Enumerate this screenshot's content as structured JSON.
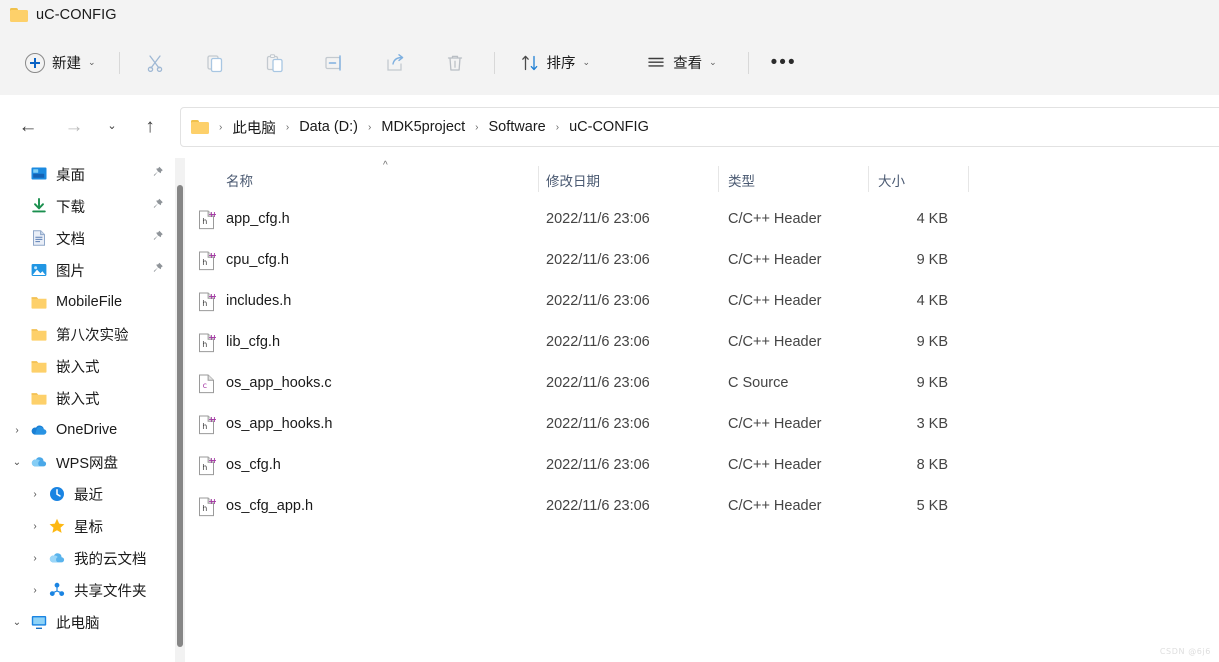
{
  "window": {
    "title": "uC-CONFIG",
    "folder_icon": "folder-icon"
  },
  "toolbar": {
    "new_label": "新建",
    "new_chevron": "⌄",
    "sort_label": "排序",
    "sort_chevron": "⌄",
    "view_label": "查看",
    "view_chevron": "⌄",
    "more_label": "•••",
    "icons": [
      {
        "name": "cut-icon",
        "tip": "剪切"
      },
      {
        "name": "copy-icon",
        "tip": "复制"
      },
      {
        "name": "paste-icon",
        "tip": "粘贴"
      },
      {
        "name": "rename-icon",
        "tip": "重命名"
      },
      {
        "name": "share-icon",
        "tip": "共享"
      },
      {
        "name": "delete-icon",
        "tip": "删除"
      }
    ]
  },
  "nav": {
    "back": "←",
    "forward": "→",
    "recent_chevron": "⌄",
    "up": "↑",
    "breadcrumb": [
      "此电脑",
      "Data (D:)",
      "MDK5project",
      "Software",
      "uC-CONFIG"
    ],
    "separator": "›"
  },
  "sidebar": {
    "items": [
      {
        "label": "桌面",
        "icon": "desktop-icon",
        "pinned": true,
        "caret": "",
        "indent": 0
      },
      {
        "label": "下载",
        "icon": "downloads-icon",
        "pinned": true,
        "caret": "",
        "indent": 0
      },
      {
        "label": "文档",
        "icon": "documents-icon",
        "pinned": true,
        "caret": "",
        "indent": 0
      },
      {
        "label": "图片",
        "icon": "pictures-icon",
        "pinned": true,
        "caret": "",
        "indent": 0
      },
      {
        "label": "MobileFile",
        "icon": "folder-icon",
        "pinned": false,
        "caret": "",
        "indent": 0
      },
      {
        "label": "第八次实验",
        "icon": "folder-icon",
        "pinned": false,
        "caret": "",
        "indent": 0
      },
      {
        "label": "嵌入式",
        "icon": "folder-icon",
        "pinned": false,
        "caret": "",
        "indent": 0
      },
      {
        "label": "嵌入式",
        "icon": "folder-icon",
        "pinned": false,
        "caret": "",
        "indent": 0
      },
      {
        "label": "OneDrive",
        "icon": "onedrive-icon",
        "pinned": false,
        "caret": "›",
        "indent": 0
      },
      {
        "label": "WPS网盘",
        "icon": "wps-cloud-icon",
        "pinned": false,
        "caret": "⌄",
        "indent": 0
      },
      {
        "label": "最近",
        "icon": "clock-icon",
        "pinned": false,
        "caret": "›",
        "indent": 1
      },
      {
        "label": "星标",
        "icon": "star-icon",
        "pinned": false,
        "caret": "›",
        "indent": 1
      },
      {
        "label": "我的云文档",
        "icon": "cloud-icon",
        "pinned": false,
        "caret": "›",
        "indent": 1
      },
      {
        "label": "共享文件夹",
        "icon": "share-folder-icon",
        "pinned": false,
        "caret": "›",
        "indent": 1
      },
      {
        "label": "此电脑",
        "icon": "this-pc-icon",
        "pinned": false,
        "caret": "⌄",
        "indent": 0
      }
    ]
  },
  "filelist": {
    "columns": {
      "name": "名称",
      "date": "修改日期",
      "type": "类型",
      "size": "大小"
    },
    "sort_indicator": "^",
    "rows": [
      {
        "name": "app_cfg.h",
        "date": "2022/11/6 23:06",
        "type": "C/C++ Header",
        "size": "4 KB",
        "icon": "h-file-icon"
      },
      {
        "name": "cpu_cfg.h",
        "date": "2022/11/6 23:06",
        "type": "C/C++ Header",
        "size": "9 KB",
        "icon": "h-file-icon"
      },
      {
        "name": "includes.h",
        "date": "2022/11/6 23:06",
        "type": "C/C++ Header",
        "size": "4 KB",
        "icon": "h-file-icon"
      },
      {
        "name": "lib_cfg.h",
        "date": "2022/11/6 23:06",
        "type": "C/C++ Header",
        "size": "9 KB",
        "icon": "h-file-icon"
      },
      {
        "name": "os_app_hooks.c",
        "date": "2022/11/6 23:06",
        "type": "C Source",
        "size": "9 KB",
        "icon": "c-file-icon"
      },
      {
        "name": "os_app_hooks.h",
        "date": "2022/11/6 23:06",
        "type": "C/C++ Header",
        "size": "3 KB",
        "icon": "h-file-icon"
      },
      {
        "name": "os_cfg.h",
        "date": "2022/11/6 23:06",
        "type": "C/C++ Header",
        "size": "8 KB",
        "icon": "h-file-icon"
      },
      {
        "name": "os_cfg_app.h",
        "date": "2022/11/6 23:06",
        "type": "C/C++ Header",
        "size": "5 KB",
        "icon": "h-file-icon"
      }
    ]
  },
  "watermark": "CSDN @6j6",
  "colors": {
    "accent": "#0a62c4",
    "chrome": "#f3f3f3",
    "header_text": "#4b5a72",
    "folder_yellow": "#fdd06a"
  }
}
